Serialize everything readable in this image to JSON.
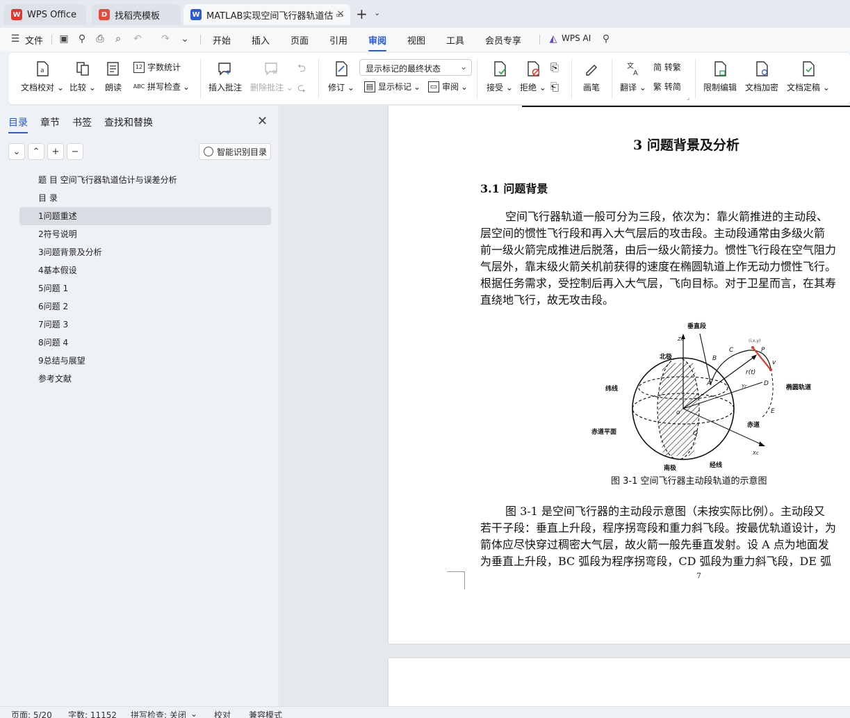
{
  "tabs": [
    {
      "label": "WPS Office",
      "icon": "wps-logo-icon"
    },
    {
      "label": "找稻壳模板",
      "icon": "docer-icon"
    },
    {
      "label": "MATLAB实现空间飞行器轨道估",
      "icon": "word-doc-icon"
    }
  ],
  "menu": {
    "file": "文件",
    "items": [
      "开始",
      "插入",
      "页面",
      "引用",
      "审阅",
      "视图",
      "工具",
      "会员专享"
    ],
    "active": "审阅",
    "wps_ai": "WPS AI"
  },
  "ribbon": {
    "proofread": "文档校对",
    "compare": "比较",
    "read_aloud": "朗读",
    "word_count": "字数统计",
    "spell_check": "拼写检查",
    "insert_comment": "插入批注",
    "delete_comment": "删除批注",
    "track_changes": "修订",
    "markup_select": "显示标记的最终状态",
    "show_markup": "显示标记",
    "review": "审阅",
    "accept": "接受",
    "reject": "拒绝",
    "pen": "画笔",
    "translate": "翻译",
    "to_traditional": "简 转繁",
    "to_simplified": "繁 转简",
    "restrict_edit": "限制编辑",
    "encrypt": "文档加密",
    "finalize": "文档定稿"
  },
  "nav": {
    "tabs": [
      "目录",
      "章节",
      "书签",
      "查找和替换"
    ],
    "active_tab": "目录",
    "smart_toc": "智能识别目录",
    "toc": [
      "题 目 空间飞行器轨道估计与误差分析",
      "目 录",
      "1问题重述",
      "2符号说明",
      "3问题背景及分析",
      "4基本假设",
      "5问题 1",
      "6问题 2",
      "7问题 3",
      "8问题 4",
      "9总结与展望",
      "参考文献"
    ],
    "selected_index": 2
  },
  "document": {
    "chapter_title": "3   问题背景及分析",
    "section_title": "3.1  问题背景",
    "para1": [
      "空间飞行器轨道一般可分为三段，依次为：靠火箭推进的主动段、",
      "层空间的惯性飞行段和再入大气层后的攻击段。主动段通常由多级火箭",
      "前一级火箭完成推进后脱落，由后一级火箭接力。惯性飞行段在空气阻力",
      "气层外，靠末级火箭关机前获得的速度在椭圆轨道上作无动力惯性飞行。",
      "根据任务需求，受控制后再入大气层，飞向目标。对于卫星而言，在其寿",
      "直绕地飞行，故无攻击段。"
    ],
    "figure_labels": {
      "vertical": "垂直段",
      "north": "北极",
      "weft": "纬线",
      "equator_plane": "赤道平面",
      "south": "南极",
      "meridian": "经线",
      "equator": "赤道",
      "ellipse": "椭圆轨道",
      "A": "A",
      "B": "B",
      "C": "C",
      "D": "D",
      "E": "E",
      "P": "P",
      "Q": "Q",
      "O": "o",
      "rt": "r(t)",
      "v": "v",
      "Zc": "Zc",
      "Yc": "Yc",
      "Xc": "Xc",
      "rxyz": "(i,x,y)"
    },
    "caption": "图 3-1    空间飞行器主动段轨道的示意图",
    "para2": [
      "图 3-1 是空间飞行器的主动段示意图（未按实际比例）。主动段又",
      "若干子段：垂直上升段，程序拐弯段和重力斜飞段。按最优轨道设计，为",
      "箭体应尽快穿过稠密大气层，故火箭一般先垂直发射。设 A 点为地面发",
      "为垂直上升段，BC 弧段为程序拐弯段，CD 弧段为重力斜飞段，DE 弧"
    ],
    "page_number": "7"
  },
  "status": {
    "page": "页面: 5/20",
    "words": "字数: 11152",
    "spell": "拼写检查: 关闭",
    "proof": "校对",
    "compat": "兼容模式"
  },
  "colors": {
    "accent": "#2b59d8",
    "wps_red": "#e0362c"
  }
}
